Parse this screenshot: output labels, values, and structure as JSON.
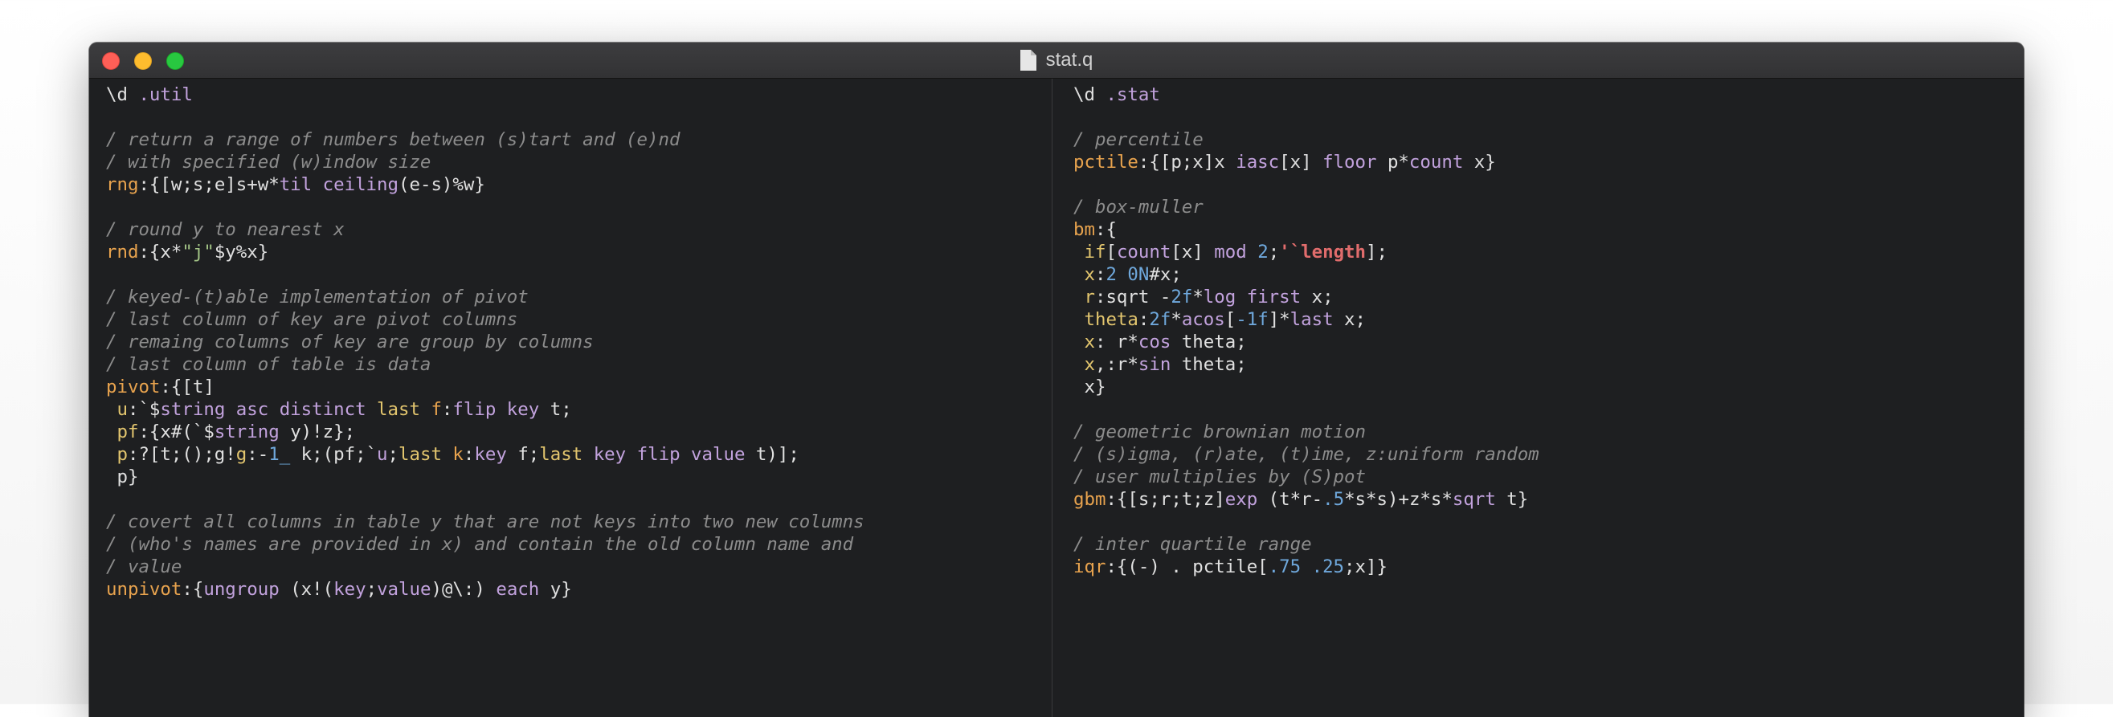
{
  "window": {
    "title": "stat.q"
  },
  "left_pane": {
    "lines": [
      [
        [
          "cursor",
          "\\"
        ],
        [
          "plain",
          "d "
        ],
        [
          "kw",
          ".util"
        ]
      ],
      [],
      [
        [
          "comment",
          "/ return a range of numbers between (s)tart and (e)nd"
        ]
      ],
      [
        [
          "comment",
          "/ with specified (w)indow size"
        ]
      ],
      [
        [
          "name",
          "rng"
        ],
        [
          "plain",
          ":{[w;s;e]s+w*"
        ],
        [
          "kw",
          "til ceiling"
        ],
        [
          "plain",
          "(e-s)%w}"
        ]
      ],
      [],
      [
        [
          "comment",
          "/ round y to nearest x"
        ]
      ],
      [
        [
          "name",
          "rnd"
        ],
        [
          "plain",
          ":{x*"
        ],
        [
          "str",
          "\"j\""
        ],
        [
          "plain",
          "$y%x}"
        ]
      ],
      [],
      [
        [
          "comment",
          "/ keyed-(t)able implementation of pivot"
        ]
      ],
      [
        [
          "comment",
          "/ last column of key are pivot columns"
        ]
      ],
      [
        [
          "comment",
          "/ remaing columns of key are group by columns"
        ]
      ],
      [
        [
          "comment",
          "/ last column of table is data"
        ]
      ],
      [
        [
          "name",
          "pivot"
        ],
        [
          "plain",
          ":{[t]"
        ]
      ],
      [
        [
          "plain",
          " "
        ],
        [
          "sym",
          "u"
        ],
        [
          "plain",
          ":`$"
        ],
        [
          "kw",
          "string asc distinct "
        ],
        [
          "sym",
          "last "
        ],
        [
          "name",
          "f"
        ],
        [
          "plain",
          ":"
        ],
        [
          "kw",
          "flip key"
        ],
        [
          "plain",
          " t;"
        ]
      ],
      [
        [
          "plain",
          " "
        ],
        [
          "sym",
          "pf"
        ],
        [
          "plain",
          ":{x#(`$"
        ],
        [
          "kw",
          "string"
        ],
        [
          "plain",
          " y)!z};"
        ]
      ],
      [
        [
          "plain",
          " "
        ],
        [
          "sym",
          "p"
        ],
        [
          "plain",
          ":?[t;();g!"
        ],
        [
          "sym",
          "g"
        ],
        [
          "plain",
          ":-"
        ],
        [
          "num",
          "1_"
        ],
        [
          "plain",
          " k;(pf;`"
        ],
        [
          "kw",
          "u"
        ],
        [
          "plain",
          ";"
        ],
        [
          "sym",
          "last "
        ],
        [
          "name",
          "k"
        ],
        [
          "plain",
          ":"
        ],
        [
          "kw",
          "key"
        ],
        [
          "plain",
          " f;"
        ],
        [
          "sym",
          "last "
        ],
        [
          "kw",
          "key flip value"
        ],
        [
          "plain",
          " t)];"
        ]
      ],
      [
        [
          "plain",
          " p}"
        ]
      ],
      [],
      [
        [
          "comment",
          "/ covert all columns in table y that are not keys into two new columns"
        ]
      ],
      [
        [
          "comment",
          "/ (who's names are provided in x) and contain the old column name and"
        ]
      ],
      [
        [
          "comment",
          "/ value"
        ]
      ],
      [
        [
          "name",
          "unpivot"
        ],
        [
          "plain",
          ":{"
        ],
        [
          "kw",
          "ungroup"
        ],
        [
          "plain",
          " (x!("
        ],
        [
          "kw",
          "key"
        ],
        [
          "plain",
          ";"
        ],
        [
          "kw",
          "value"
        ],
        [
          "plain",
          ")@\\:) "
        ],
        [
          "kw",
          "each"
        ],
        [
          "plain",
          " y}"
        ]
      ]
    ]
  },
  "right_pane": {
    "lines": [
      [
        [
          "cursor",
          "\\"
        ],
        [
          "plain",
          "d "
        ],
        [
          "kw",
          ".stat"
        ]
      ],
      [],
      [
        [
          "comment",
          "/ percentile"
        ]
      ],
      [
        [
          "name",
          "pctile"
        ],
        [
          "plain",
          ":{[p;x]x "
        ],
        [
          "kw",
          "iasc"
        ],
        [
          "plain",
          "[x] "
        ],
        [
          "kw",
          "floor"
        ],
        [
          "plain",
          " p*"
        ],
        [
          "kw",
          "count"
        ],
        [
          "plain",
          " x}"
        ]
      ],
      [],
      [
        [
          "comment",
          "/ box-muller"
        ]
      ],
      [
        [
          "name",
          "bm"
        ],
        [
          "plain",
          ":{"
        ]
      ],
      [
        [
          "plain",
          " "
        ],
        [
          "sym",
          "if"
        ],
        [
          "plain",
          "["
        ],
        [
          "kw",
          "count"
        ],
        [
          "plain",
          "[x] "
        ],
        [
          "kw",
          "mod"
        ],
        [
          "plain",
          " "
        ],
        [
          "num",
          "2"
        ],
        [
          "plain",
          ";"
        ],
        [
          "bold",
          "'`length"
        ],
        [
          "plain",
          "];"
        ]
      ],
      [
        [
          "plain",
          " "
        ],
        [
          "sym",
          "x"
        ],
        [
          "plain",
          ":"
        ],
        [
          "num",
          "2 0N"
        ],
        [
          "plain",
          "#x;"
        ]
      ],
      [
        [
          "plain",
          " "
        ],
        [
          "sym",
          "r"
        ],
        [
          "plain",
          ":sqrt -"
        ],
        [
          "num",
          "2f"
        ],
        [
          "plain",
          "*"
        ],
        [
          "kw",
          "log first"
        ],
        [
          "plain",
          " x;"
        ]
      ],
      [
        [
          "plain",
          " "
        ],
        [
          "sym",
          "theta"
        ],
        [
          "plain",
          ":"
        ],
        [
          "num",
          "2f"
        ],
        [
          "plain",
          "*"
        ],
        [
          "kw",
          "acos"
        ],
        [
          "plain",
          "["
        ],
        [
          "num",
          "-1f"
        ],
        [
          "plain",
          "]*"
        ],
        [
          "kw",
          "last"
        ],
        [
          "plain",
          " x;"
        ]
      ],
      [
        [
          "plain",
          " "
        ],
        [
          "sym",
          "x"
        ],
        [
          "plain",
          ": r*"
        ],
        [
          "kw",
          "cos"
        ],
        [
          "plain",
          " theta;"
        ]
      ],
      [
        [
          "plain",
          " "
        ],
        [
          "sym",
          "x"
        ],
        [
          "plain",
          ",:r*"
        ],
        [
          "kw",
          "sin"
        ],
        [
          "plain",
          " theta;"
        ]
      ],
      [
        [
          "plain",
          " x}"
        ]
      ],
      [],
      [
        [
          "comment",
          "/ geometric brownian motion"
        ]
      ],
      [
        [
          "comment",
          "/ (s)igma, (r)ate, (t)ime, z:uniform random"
        ]
      ],
      [
        [
          "comment",
          "/ user multiplies by (S)pot"
        ]
      ],
      [
        [
          "name",
          "gbm"
        ],
        [
          "plain",
          ":{[s;r;t;z]"
        ],
        [
          "kw",
          "exp"
        ],
        [
          "plain",
          " (t*r-"
        ],
        [
          "num",
          ".5"
        ],
        [
          "plain",
          "*s*s)+z*s*"
        ],
        [
          "kw",
          "sqrt"
        ],
        [
          "plain",
          " t}"
        ]
      ],
      [],
      [
        [
          "comment",
          "/ inter quartile range"
        ]
      ],
      [
        [
          "name",
          "iqr"
        ],
        [
          "plain",
          ":{(-) . pctile["
        ],
        [
          "num",
          ".75 .25"
        ],
        [
          "plain",
          ";x]}"
        ]
      ]
    ]
  }
}
